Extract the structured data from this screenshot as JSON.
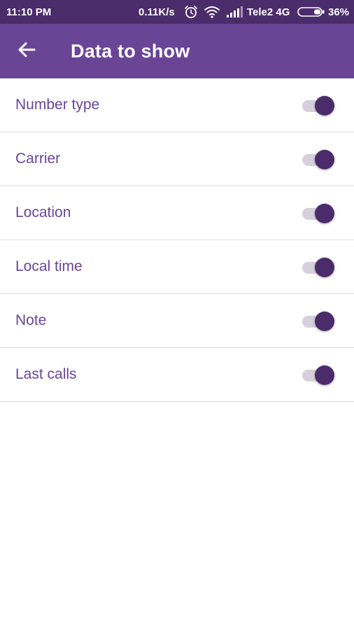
{
  "status_bar": {
    "time": "11:10 PM",
    "speed": "0.11K/s",
    "carrier": "Tele2 4G",
    "battery": "36%",
    "icons": [
      "alarm-icon",
      "wifi-icon",
      "signal-icon",
      "battery-icon"
    ]
  },
  "app_bar": {
    "title": "Data to show",
    "back_icon": "back-arrow-icon"
  },
  "settings": {
    "items": [
      {
        "label": "Number type",
        "enabled": true
      },
      {
        "label": "Carrier",
        "enabled": true
      },
      {
        "label": "Location",
        "enabled": true
      },
      {
        "label": "Local time",
        "enabled": true
      },
      {
        "label": "Note",
        "enabled": true
      },
      {
        "label": "Last calls",
        "enabled": true
      }
    ]
  },
  "colors": {
    "status_bar": "#4b2c6a",
    "app_bar": "#6a4596",
    "label_text": "#6a4596",
    "toggle_thumb": "#4b2c6a",
    "toggle_track": "#d6d0dd"
  }
}
